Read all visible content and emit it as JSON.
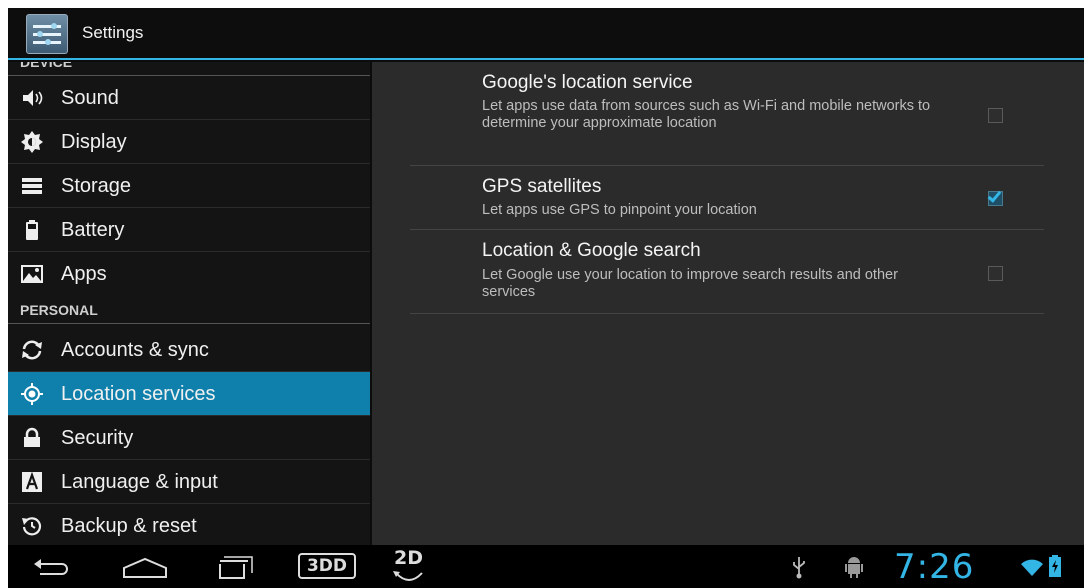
{
  "app": {
    "title": "Settings"
  },
  "sidebar": {
    "section_device": "DEVICE",
    "section_personal": "PERSONAL",
    "items": [
      {
        "label": "Sound",
        "icon": "speaker-icon"
      },
      {
        "label": "Display",
        "icon": "brightness-icon"
      },
      {
        "label": "Storage",
        "icon": "storage-icon"
      },
      {
        "label": "Battery",
        "icon": "battery-icon"
      },
      {
        "label": "Apps",
        "icon": "apps-icon"
      },
      {
        "label": "Accounts & sync",
        "icon": "sync-icon"
      },
      {
        "label": "Location services",
        "icon": "location-icon",
        "selected": true
      },
      {
        "label": "Security",
        "icon": "lock-icon"
      },
      {
        "label": "Language & input",
        "icon": "keyboard-icon"
      },
      {
        "label": "Backup & reset",
        "icon": "backup-icon"
      }
    ]
  },
  "preferences": [
    {
      "title": "Google's location service",
      "summary": "Let apps use data from sources such as Wi-Fi and mobile networks to determine your approximate location",
      "checked": false
    },
    {
      "title": "GPS satellites",
      "summary": "Let apps use GPS to pinpoint your location",
      "checked": true
    },
    {
      "title": "Location & Google search",
      "summary": "Let Google use your location to improve search results and other services",
      "checked": false
    }
  ],
  "system_bar": {
    "mode_3d": "3DD",
    "mode_2d": "2D",
    "clock": "7:26"
  },
  "colors": {
    "accent": "#33b5e5",
    "selected_item": "#0f80ac",
    "content_bg": "#2b2b2b"
  }
}
